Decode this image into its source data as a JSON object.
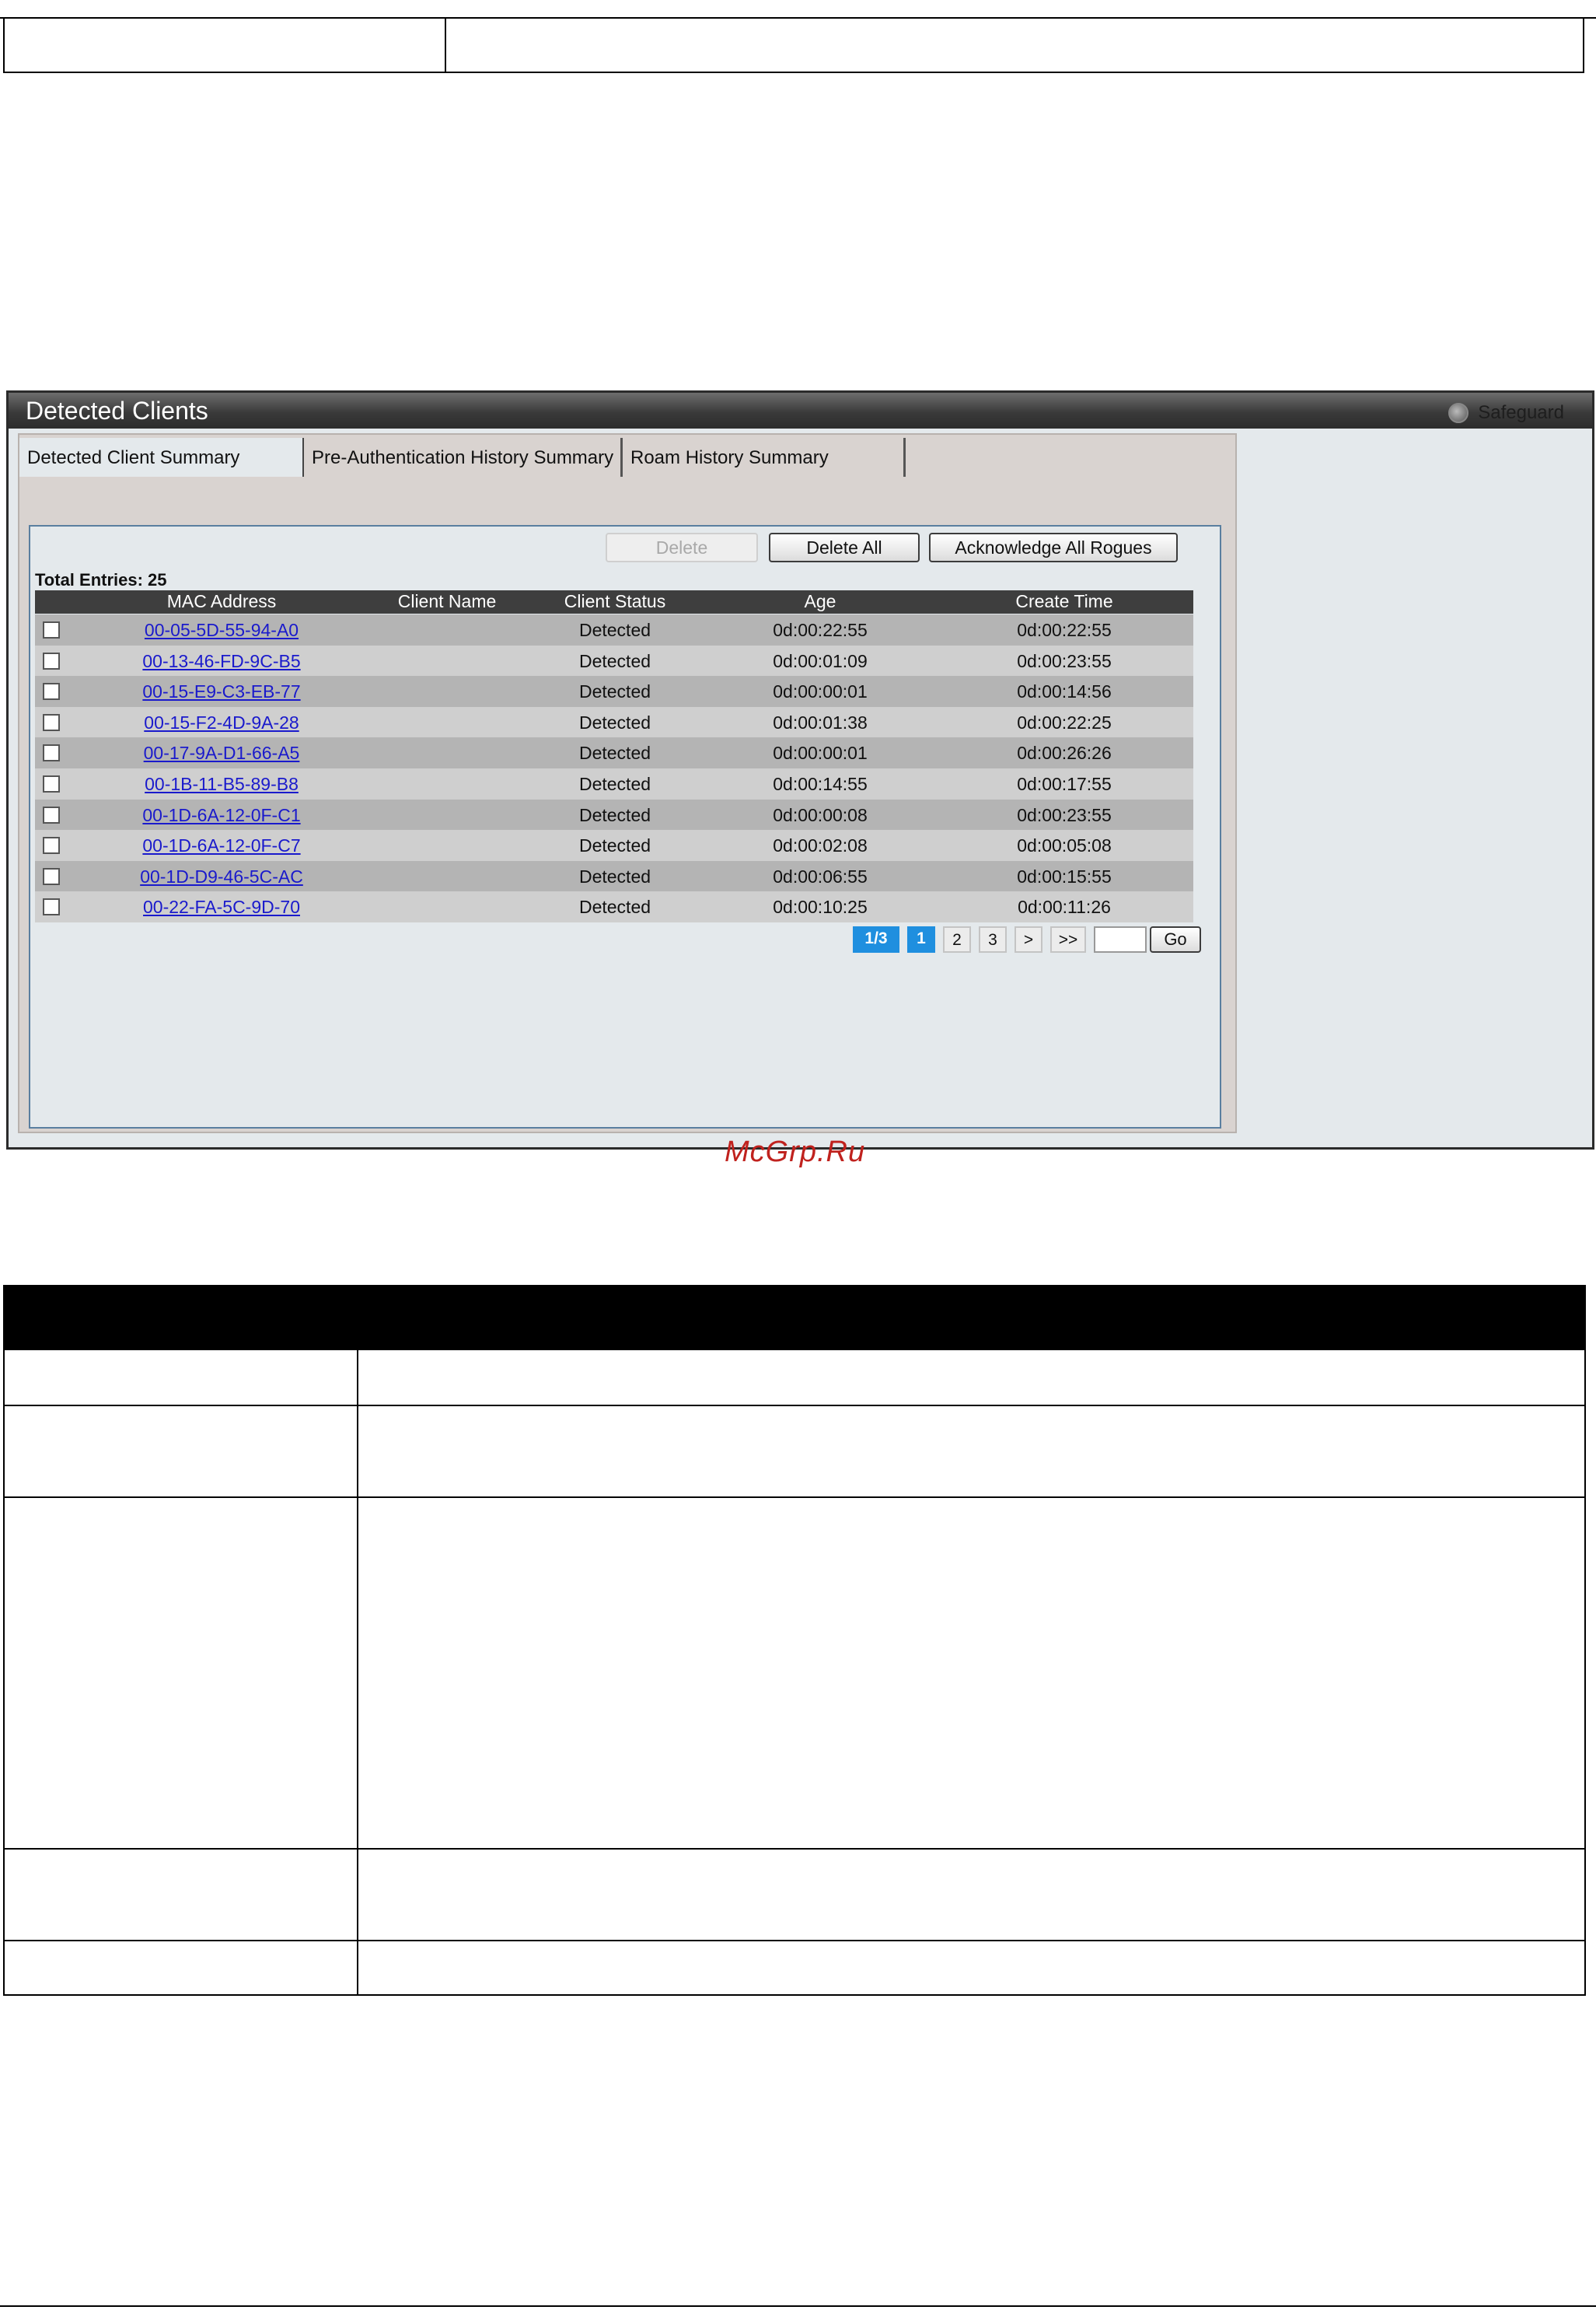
{
  "window": {
    "title": "Detected Clients",
    "brand": "Safeguard"
  },
  "tabs": [
    {
      "label": "Detected Client Summary",
      "active": true
    },
    {
      "label": "Pre-Authentication History Summary",
      "active": false
    },
    {
      "label": "Roam History Summary",
      "active": false
    }
  ],
  "toolbar": {
    "delete_label": "Delete",
    "delete_all_label": "Delete All",
    "acknowledge_label": "Acknowledge All Rogues"
  },
  "summary": {
    "total_entries": "Total Entries: 25"
  },
  "table": {
    "columns": [
      "MAC Address",
      "Client Name",
      "Client Status",
      "Age",
      "Create Time"
    ],
    "rows": [
      {
        "mac": "00-05-5D-55-94-A0",
        "client_name": "",
        "status": "Detected",
        "age": "0d:00:22:55",
        "create_time": "0d:00:22:55"
      },
      {
        "mac": "00-13-46-FD-9C-B5",
        "client_name": "",
        "status": "Detected",
        "age": "0d:00:01:09",
        "create_time": "0d:00:23:55"
      },
      {
        "mac": "00-15-E9-C3-EB-77",
        "client_name": "",
        "status": "Detected",
        "age": "0d:00:00:01",
        "create_time": "0d:00:14:56"
      },
      {
        "mac": "00-15-F2-4D-9A-28",
        "client_name": "",
        "status": "Detected",
        "age": "0d:00:01:38",
        "create_time": "0d:00:22:25"
      },
      {
        "mac": "00-17-9A-D1-66-A5",
        "client_name": "",
        "status": "Detected",
        "age": "0d:00:00:01",
        "create_time": "0d:00:26:26"
      },
      {
        "mac": "00-1B-11-B5-89-B8",
        "client_name": "",
        "status": "Detected",
        "age": "0d:00:14:55",
        "create_time": "0d:00:17:55"
      },
      {
        "mac": "00-1D-6A-12-0F-C1",
        "client_name": "",
        "status": "Detected",
        "age": "0d:00:00:08",
        "create_time": "0d:00:23:55"
      },
      {
        "mac": "00-1D-6A-12-0F-C7",
        "client_name": "",
        "status": "Detected",
        "age": "0d:00:02:08",
        "create_time": "0d:00:05:08"
      },
      {
        "mac": "00-1D-D9-46-5C-AC",
        "client_name": "",
        "status": "Detected",
        "age": "0d:00:06:55",
        "create_time": "0d:00:15:55"
      },
      {
        "mac": "00-22-FA-5C-9D-70",
        "client_name": "",
        "status": "Detected",
        "age": "0d:00:10:25",
        "create_time": "0d:00:11:26"
      }
    ]
  },
  "pagination": {
    "current": "1/3",
    "pages": [
      "1",
      "2",
      "3"
    ],
    "next": ">",
    "last": ">>",
    "go_label": "Go",
    "input_value": ""
  },
  "watermark": "McGrp.Ru",
  "colors": {
    "title_bar": "#3a3a3a",
    "link": "#1a1acc",
    "pager_active": "#1f8fdf",
    "watermark": "#c0221e"
  }
}
